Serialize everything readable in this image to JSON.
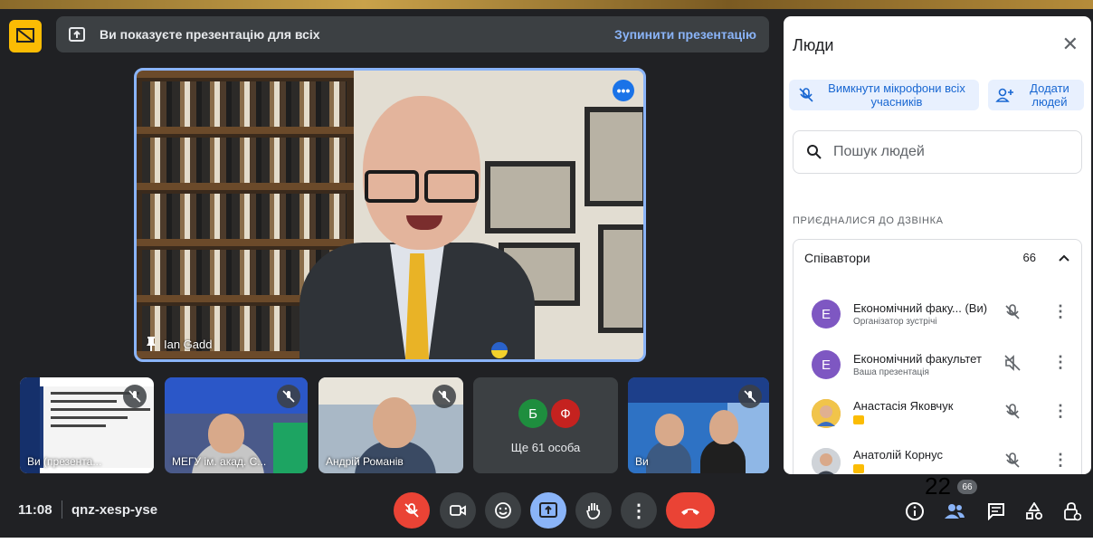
{
  "banner": {
    "text": "Ви показуєте презентацію для всіх",
    "stop_label": "Зупинити презентацію"
  },
  "main_speaker": {
    "name": "Ian Gadd"
  },
  "thumbnails": [
    {
      "label": "Ви (презента..."
    },
    {
      "label": "МЕГУ ім. акад. С..."
    },
    {
      "label": "Андрій Романів"
    },
    {
      "label": "Ще 61 особа",
      "avatars": [
        {
          "letter": "Б",
          "color": "#1e8e3e"
        },
        {
          "letter": "Ф",
          "color": "#c5221f"
        }
      ]
    },
    {
      "label": "Ви"
    }
  ],
  "panel": {
    "title": "Люди",
    "mute_all_label": "Вимкнути мікрофони всіх учасників",
    "add_people_label": "Додати людей",
    "search_placeholder": "Пошук людей",
    "section_heading": "ПРИЄДНАЛИСЯ ДО ДЗВІНКА",
    "group": {
      "name": "Співавтори",
      "count": "66"
    },
    "participants": [
      {
        "initial": "Е",
        "name": "Економічний факу... (Ви)",
        "subtitle": "Організатор зустрічі"
      },
      {
        "initial": "Е",
        "name": "Економічний факультет",
        "subtitle": "Ваша презентація"
      },
      {
        "initial": "",
        "name": "Анастасія Яковчук",
        "subtitle": ""
      },
      {
        "initial": "",
        "name": "Анатолій Корнус",
        "subtitle": ""
      }
    ]
  },
  "bottom_bar": {
    "time": "11:08",
    "meeting_code": "qnz-xesp-yse",
    "overlay_number": "22",
    "people_count": "66"
  },
  "colors": {
    "background": "#202124",
    "accent": "#8ab4f8",
    "danger": "#ea4335",
    "present_highlight": "#fbbc04"
  }
}
